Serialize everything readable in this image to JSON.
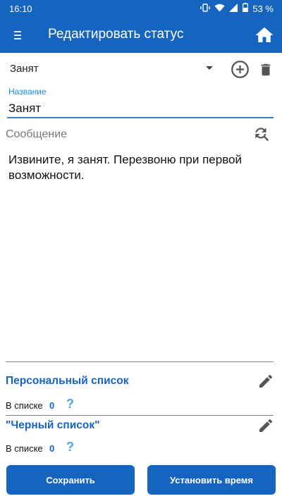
{
  "status_bar": {
    "time": "16:10",
    "battery": "53 %"
  },
  "app_bar": {
    "title": "Редактировать статус"
  },
  "status_select": {
    "value": "Занят"
  },
  "name_field": {
    "label": "Название",
    "value": "Занят"
  },
  "message": {
    "label": "Сообщение",
    "text": "Извините, я занят. Перезвоню при первой возможности."
  },
  "personal_list": {
    "title": "Персональный список",
    "count_label": "В списке",
    "count": "0",
    "help": "?"
  },
  "black_list": {
    "title": "\"Черный список\"",
    "count_label": "В списке",
    "count": "0",
    "help": "?"
  },
  "buttons": {
    "save": "Сохранить",
    "set_time": "Установить время"
  },
  "colors": {
    "primary": "#1565c0",
    "accent": "#1e88e5",
    "help": "#42a5f5"
  }
}
